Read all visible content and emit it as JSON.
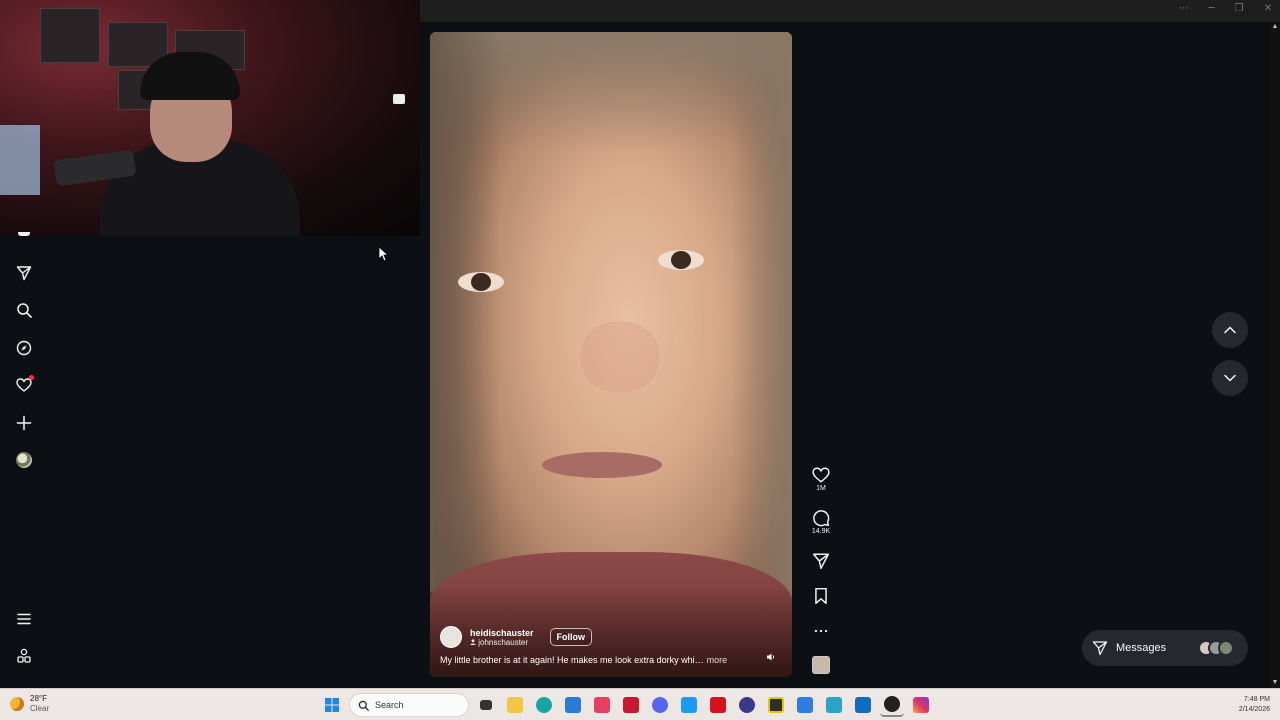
{
  "window": {
    "controls": [
      "⋯",
      "─",
      "❐",
      "✕"
    ]
  },
  "nav": {
    "items": [
      "reels",
      "messages",
      "search",
      "explore",
      "notifications",
      "create",
      "profile",
      "more",
      "also-from-meta"
    ]
  },
  "reel": {
    "username": "heidischauster",
    "collaborator": "johnschauster",
    "follow_label": "Follow",
    "caption": "My little brother is at it again! He makes me look extra dorky whi…",
    "more_label": "more"
  },
  "actions": {
    "likes": "1M",
    "comments": "14.9K"
  },
  "messages": {
    "label": "Messages"
  },
  "taskbar": {
    "weather_temp": "28°F",
    "weather_cond": "Clear",
    "search_label": "Search",
    "time": "7:48 PM",
    "date": "2/14/2026"
  },
  "colors": {
    "app_bg": "#0c1014",
    "panel_button": "#25292e",
    "notification_dot": "#ff3040",
    "taskbar_bg": "#ece7e4"
  }
}
